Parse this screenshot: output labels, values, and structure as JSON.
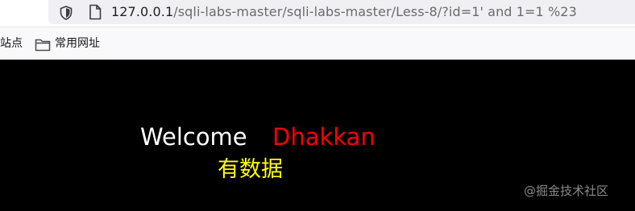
{
  "browser": {
    "url_host": "127.0.0.1",
    "url_path": "/sqli-labs-master/sqli-labs-master/Less-8/?id=1' and 1=1 %23",
    "icons": [
      "shield-icon",
      "page-icon"
    ]
  },
  "bookmarks": {
    "partial_label": "站点",
    "items": [
      {
        "label": "常用网址",
        "icon": "folder-icon"
      }
    ]
  },
  "page": {
    "welcome": "Welcome",
    "name": "Dhakkan",
    "status": "有数据",
    "watermark": "@掘金技术社区",
    "colors": {
      "background": "#000000",
      "welcome": "#ffffff",
      "name": "#ff0000",
      "status": "#ffff00"
    }
  }
}
